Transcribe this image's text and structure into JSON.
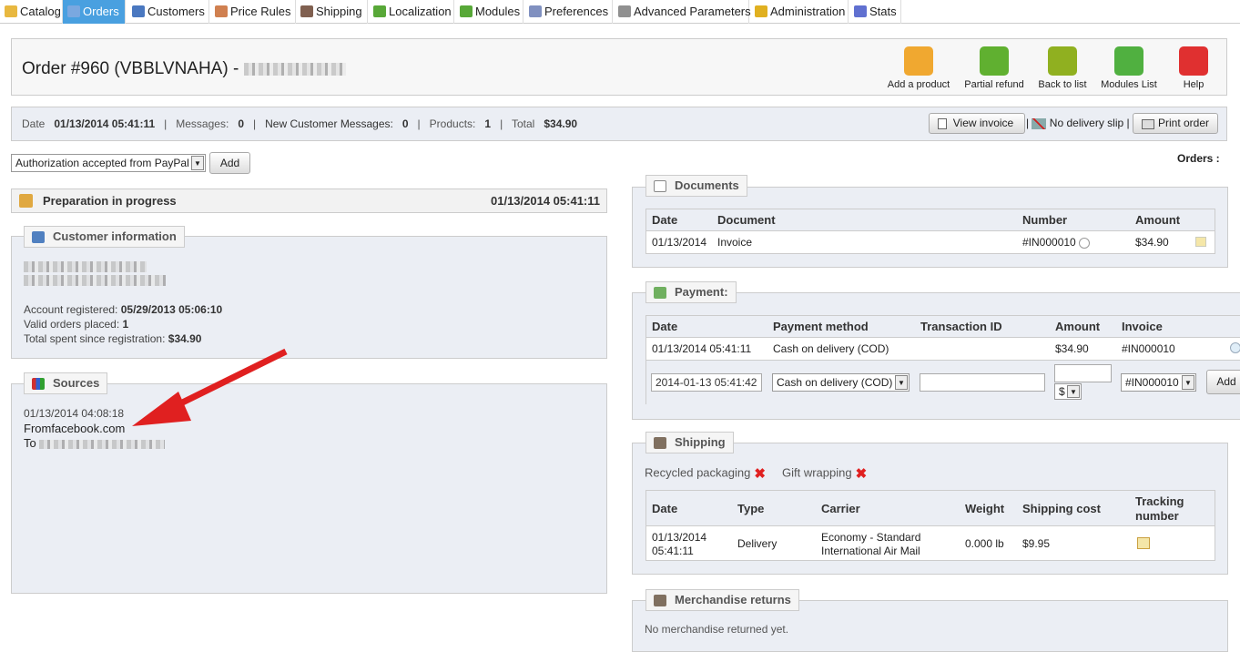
{
  "tabs": [
    {
      "label": "Catalog",
      "color": "#e8b840"
    },
    {
      "label": "Orders",
      "color": "#7aa8e0"
    },
    {
      "label": "Customers",
      "color": "#4a78c0"
    },
    {
      "label": "Price Rules",
      "color": "#d08050"
    },
    {
      "label": "Shipping",
      "color": "#806050"
    },
    {
      "label": "Localization",
      "color": "#58a838"
    },
    {
      "label": "Modules",
      "color": "#58a838"
    },
    {
      "label": "Preferences",
      "color": "#8090c0"
    },
    {
      "label": "Advanced Parameters",
      "color": "#909090"
    },
    {
      "label": "Administration",
      "color": "#e0b020"
    },
    {
      "label": "Stats",
      "color": "#6070d0"
    }
  ],
  "header": {
    "title": "Order #960 (VBBLVNAHA) -"
  },
  "toolbar": [
    {
      "label": "Add a product",
      "icon": "add-product-icon",
      "color": "#f0a830"
    },
    {
      "label": "Partial refund",
      "icon": "refund-icon",
      "color": "#60b030"
    },
    {
      "label": "Back to list",
      "icon": "back-icon",
      "color": "#90b020"
    },
    {
      "label": "Modules List",
      "icon": "puzzle-icon",
      "color": "#50b040"
    },
    {
      "label": "Help",
      "icon": "lifebuoy-icon",
      "color": "#e03030"
    }
  ],
  "summary": {
    "date_label": "Date",
    "date": "01/13/2014 05:41:11",
    "messages_label": "Messages:",
    "messages": "0",
    "new_messages_label": "New Customer Messages:",
    "new_messages": "0",
    "products_label": "Products:",
    "products": "1",
    "total_label": "Total",
    "total": "$34.90",
    "view_invoice": "View invoice",
    "no_delivery": "No delivery slip",
    "print_order": "Print order"
  },
  "status": {
    "selected": "Authorization accepted from PayPal",
    "add": "Add",
    "orders_label": "Orders :"
  },
  "state_bar": {
    "label": "Preparation in progress",
    "date": "01/13/2014 05:41:11"
  },
  "customer": {
    "legend": "Customer information",
    "registered_label": "Account registered:",
    "registered": "05/29/2013 05:06:10",
    "valid_label": "Valid orders placed:",
    "valid": "1",
    "spent_label": "Total spent since registration:",
    "spent": "$34.90"
  },
  "sources": {
    "legend": "Sources",
    "date": "01/13/2014 04:08:18",
    "from_label": "From",
    "from": "facebook.com",
    "to_label": "To"
  },
  "documents": {
    "legend": "Documents",
    "headers": [
      "Date",
      "Document",
      "Number",
      "Amount"
    ],
    "rows": [
      {
        "date": "01/13/2014",
        "document": "Invoice",
        "number": "#IN000010",
        "amount": "$34.90"
      }
    ]
  },
  "payment": {
    "legend": "Payment:",
    "headers": [
      "Date",
      "Payment method",
      "Transaction ID",
      "Amount",
      "Invoice"
    ],
    "rows": [
      {
        "date": "01/13/2014 05:41:11",
        "method": "Cash on delivery (COD)",
        "transaction": "",
        "amount": "$34.90",
        "invoice": "#IN000010"
      }
    ],
    "form": {
      "date": "2014-01-13 05:41:42",
      "method": "Cash on delivery (COD)",
      "transaction": "",
      "amount": "",
      "currency": "$",
      "invoice": "#IN000010",
      "add": "Add"
    }
  },
  "shipping": {
    "legend": "Shipping",
    "recycled": "Recycled packaging",
    "gift": "Gift wrapping",
    "headers": [
      "Date",
      "Type",
      "Carrier",
      "Weight",
      "Shipping cost",
      "Tracking",
      "number"
    ],
    "rows": [
      {
        "date": "01/13/2014",
        "time": "05:41:11",
        "type": "Delivery",
        "carrier1": "Economy - Standard",
        "carrier2": "International Air Mail",
        "weight": "0.000 lb",
        "cost": "$9.95"
      }
    ]
  },
  "returns": {
    "legend": "Merchandise returns",
    "text": "No merchandise returned yet."
  }
}
